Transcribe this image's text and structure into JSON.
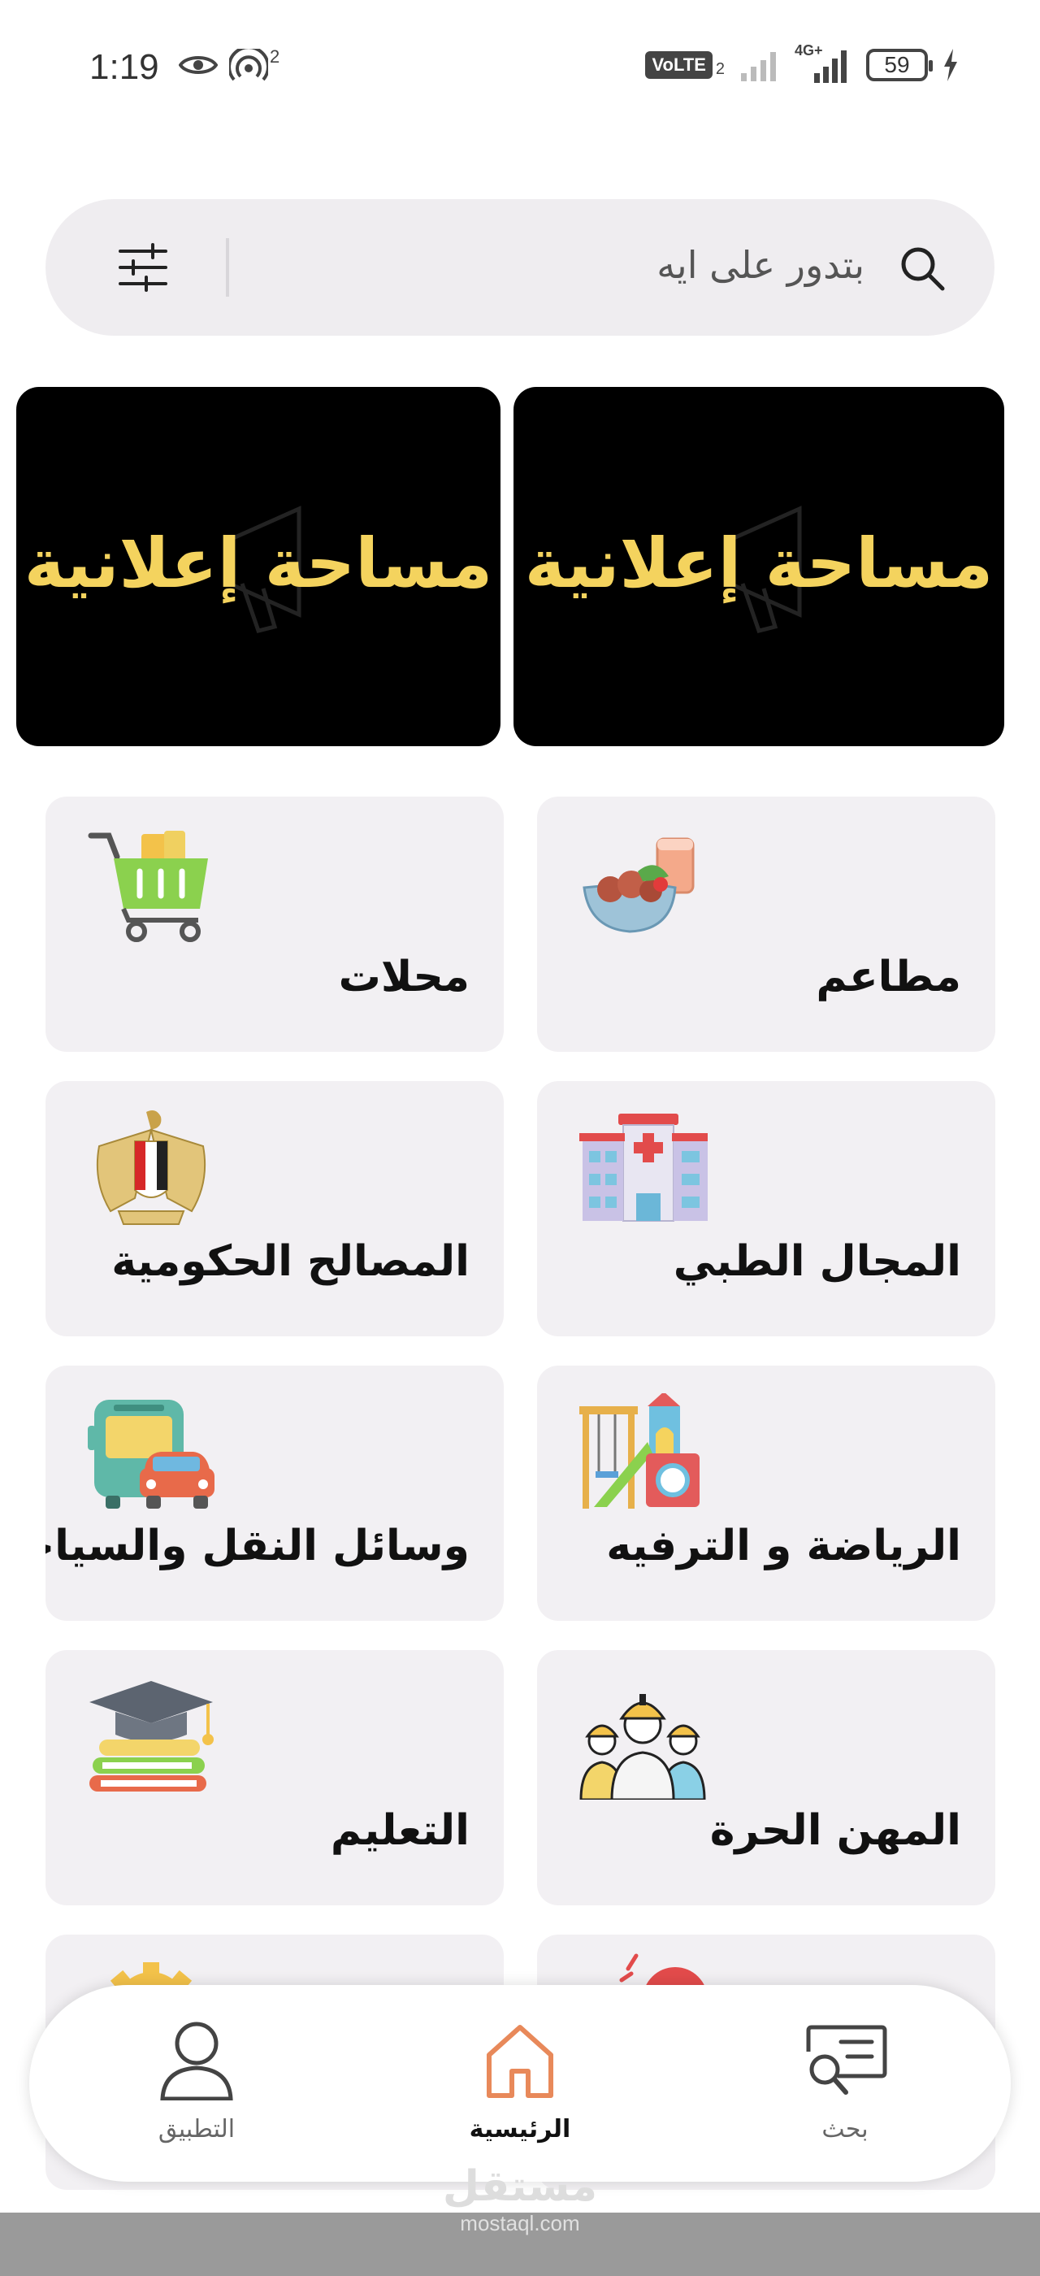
{
  "status_bar": {
    "time": "1:19",
    "hotspot_count": "2",
    "network_label": "VoLTE",
    "sim_number": "2",
    "data_type": "4G+",
    "battery_level": "59"
  },
  "search": {
    "placeholder": "بتدور على ايه"
  },
  "ads": [
    {
      "text": "مساحة إعلانية"
    },
    {
      "text": "مساحة إعلانية"
    }
  ],
  "categories": [
    {
      "label": "مطاعم",
      "icon": "food-bowl-icon"
    },
    {
      "label": "محلات",
      "icon": "shopping-cart-icon"
    },
    {
      "label": "المجال الطبي",
      "icon": "hospital-icon"
    },
    {
      "label": "المصالح الحكومية",
      "icon": "eagle-emblem-icon"
    },
    {
      "label": "الرياضة و الترفيه",
      "icon": "playground-icon"
    },
    {
      "label": "وسائل النقل والسياحة",
      "icon": "bus-car-icon"
    },
    {
      "label": "المهن الحرة",
      "icon": "workers-icon"
    },
    {
      "label": "التعليم",
      "icon": "graduation-books-icon"
    }
  ],
  "bottom_nav": {
    "items": [
      {
        "label": "التطبيق",
        "icon": "user-icon"
      },
      {
        "label": "الرئيسية",
        "icon": "home-icon",
        "active": true
      },
      {
        "label": "بحث",
        "icon": "chat-search-icon"
      }
    ]
  },
  "watermark": {
    "arabic": "مستقل",
    "latin": "mostaql.com"
  },
  "colors": {
    "accent": "#e8895a",
    "ad_text": "#f4d35e",
    "card_bg": "#f2f0f3"
  }
}
